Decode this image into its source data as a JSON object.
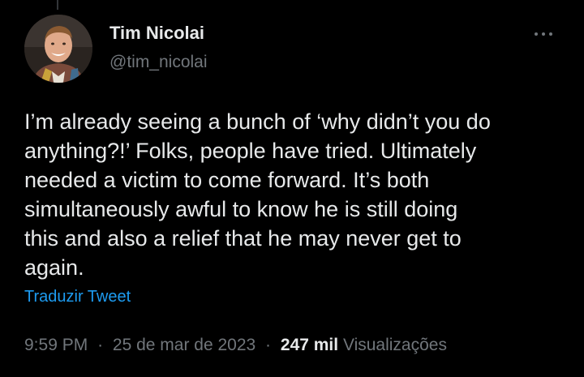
{
  "author": {
    "name": "Tim Nicolai",
    "handle": "@tim_nicolai"
  },
  "tweet": {
    "lines": [
      "I’m already seeing a bunch of ‘why didn’t you do",
      "anything?!’ Folks, people have tried. Ultimately",
      "needed a victim to come forward. It’s both",
      "simultaneously awful to know he is still doing",
      "this and also a relief that he may never get to",
      "again."
    ],
    "translate_label": "Traduzir Tweet"
  },
  "meta": {
    "time": "9:59 PM",
    "separator": "·",
    "date": "25 de mar de 2023",
    "views_count": "247 mil",
    "views_label": "Visualizações"
  },
  "icons": {
    "more": "more-horizontal-icon"
  },
  "colors": {
    "background": "#000000",
    "primary_text": "#e7e9ea",
    "secondary_text": "#71767b",
    "link": "#1d9bf0"
  }
}
